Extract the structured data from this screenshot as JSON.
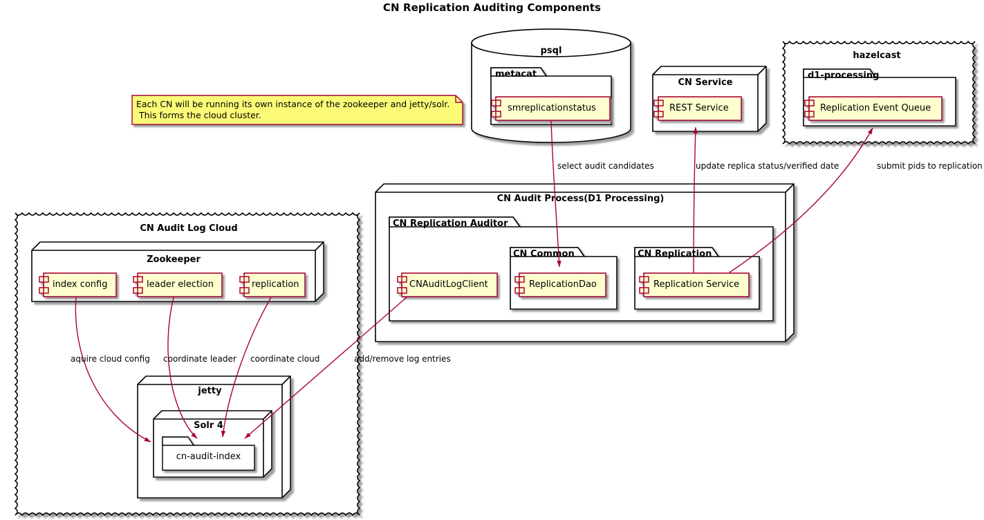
{
  "diagram": {
    "title": "CN Replication Auditing Components",
    "type": "uml-component-diagram",
    "colors": {
      "component_fill": "#FEFECE",
      "component_border": "#A80036",
      "node_fill": "#FFFFFF",
      "node_border": "#000000",
      "note_fill": "#FBFB77",
      "note_border": "#A80036",
      "edge_color": "#A80036",
      "shadow": "#808080",
      "text": "#000000"
    }
  },
  "note": {
    "id": "note-cloud-cluster",
    "line1": "Each CN will be running its own instance of the zookeeper and jetty/solr.",
    "line2": " This forms the cloud cluster."
  },
  "nodes": {
    "psql": {
      "label": "psql",
      "shape": "database",
      "package": {
        "label": "metacat",
        "shape": "folder",
        "component": {
          "label": "smreplicationstatus"
        }
      }
    },
    "cn_service": {
      "label": "CN Service",
      "shape": "node",
      "component": {
        "label": "REST Service"
      }
    },
    "hazelcast": {
      "label": "hazelcast",
      "shape": "cloud",
      "package": {
        "label": "d1-processing",
        "shape": "folder",
        "component": {
          "label": "Replication Event Queue"
        }
      }
    },
    "cn_audit_process": {
      "label": "CN Audit Process(D1 Processing)",
      "shape": "node",
      "package": {
        "label": "CN Replication Auditor",
        "shape": "folder",
        "components": [
          {
            "label": "CNAuditLogClient"
          }
        ],
        "subpackages": [
          {
            "label": "CN Common",
            "shape": "folder",
            "component": {
              "label": "ReplicationDao"
            }
          },
          {
            "label": "CN Replication",
            "shape": "folder",
            "component": {
              "label": "Replication Service"
            }
          }
        ]
      }
    },
    "cn_audit_log_cloud": {
      "label": "CN Audit Log Cloud",
      "shape": "cloud",
      "zookeeper": {
        "label": "Zookeeper",
        "shape": "node",
        "components": [
          {
            "label": "index config"
          },
          {
            "label": "leader election"
          },
          {
            "label": "replication"
          }
        ]
      },
      "jetty": {
        "label": "jetty",
        "shape": "node",
        "solr": {
          "label": "Solr 4",
          "shape": "node",
          "folder": {
            "label": "cn-audit-index",
            "shape": "folder"
          }
        }
      }
    }
  },
  "edges": [
    {
      "id": "edge-smreplicationstatus-replicationdao",
      "from": "smreplicationstatus",
      "to": "ReplicationDao",
      "label": "select audit candidates",
      "arrow": true
    },
    {
      "id": "edge-replicationservice-restservice",
      "from": "Replication Service",
      "to": "REST Service",
      "label": "update replica status/verified date",
      "arrow": true
    },
    {
      "id": "edge-replicationservice-eventqueue",
      "from": "Replication Service",
      "to": "Replication Event Queue",
      "label": "submit pids to replication",
      "arrow": true
    },
    {
      "id": "edge-indexconfig-cnauditindex",
      "from": "index config",
      "to": "cn-audit-index",
      "label": "aquire cloud config",
      "arrow": true
    },
    {
      "id": "edge-leaderelection-cnauditindex",
      "from": "leader election",
      "to": "cn-audit-index",
      "label": "coordinate leader",
      "arrow": true
    },
    {
      "id": "edge-replication-cnauditindex",
      "from": "replication",
      "to": "cn-audit-index",
      "label": "coordinate cloud",
      "arrow": true
    },
    {
      "id": "edge-cnauditlogclient-cnauditindex",
      "from": "CNAuditLogClient",
      "to": "cn-audit-index",
      "label": "add/remove log entries",
      "arrow": true
    }
  ]
}
